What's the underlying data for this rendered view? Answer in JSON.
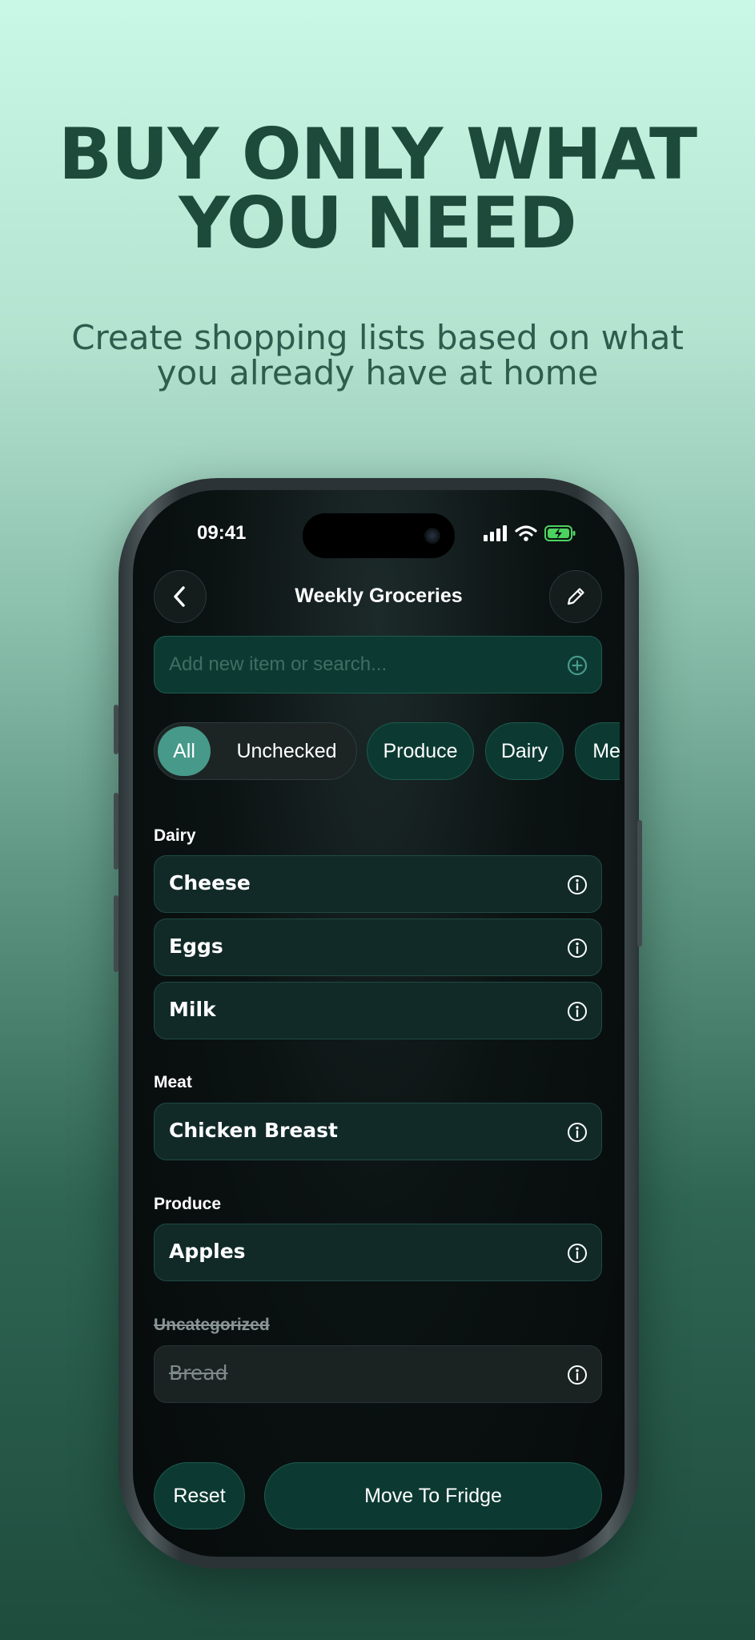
{
  "hero": {
    "title_line1": "BUY ONLY WHAT",
    "title_line2": "YOU NEED",
    "subtitle_line1": "Create shopping lists based on what",
    "subtitle_line2": "you already have at home"
  },
  "status_bar": {
    "time": "09:41",
    "icons": [
      "cellular-signal-icon",
      "wifi-icon",
      "battery-charging-icon"
    ]
  },
  "nav": {
    "title": "Weekly Groceries",
    "back_icon": "chevron-left-icon",
    "edit_icon": "pencil-icon"
  },
  "search": {
    "placeholder": "Add new item or search...",
    "add_icon": "plus-circle-icon"
  },
  "filters": {
    "segment": [
      "All",
      "Unchecked"
    ],
    "selected": "All",
    "chips": [
      "Produce",
      "Dairy",
      "Meat"
    ]
  },
  "sections": [
    {
      "label": "Dairy",
      "items": [
        "Cheese",
        "Eggs",
        "Milk"
      ]
    },
    {
      "label": "Meat",
      "items": [
        "Chicken Breast"
      ]
    },
    {
      "label": "Produce",
      "items": [
        "Apples"
      ]
    },
    {
      "label": "Uncategorized",
      "items": [
        "Bread"
      ],
      "checked": true
    }
  ],
  "actions": {
    "reset": "Reset",
    "move": "Move To Fridge"
  },
  "colors": {
    "accent": "#47998a",
    "headline": "#1e4a3b",
    "item_bg": "#112a28",
    "chip_bg": "#0c3a32"
  }
}
